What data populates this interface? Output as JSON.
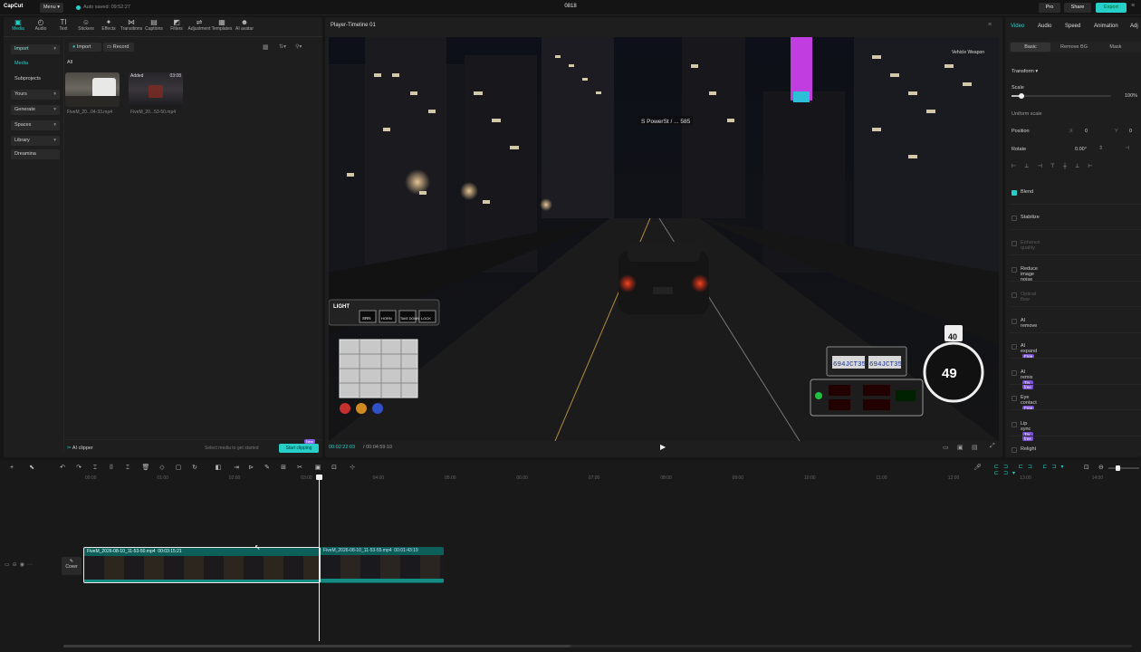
{
  "app": {
    "logo": "CapCut",
    "menu": "Menu",
    "autosave": "Auto saved: 09:52:27",
    "project_title": "0818",
    "pro": "Pro",
    "share": "Share",
    "export": "Export"
  },
  "toolbar": [
    {
      "label": "Media",
      "icon": "▣"
    },
    {
      "label": "Audio",
      "icon": "◴"
    },
    {
      "label": "Text",
      "icon": "TI"
    },
    {
      "label": "Stickers",
      "icon": "☺"
    },
    {
      "label": "Effects",
      "icon": "✦"
    },
    {
      "label": "Transitions",
      "icon": "⋈"
    },
    {
      "label": "Captions",
      "icon": "▤"
    },
    {
      "label": "Filters",
      "icon": "◩"
    },
    {
      "label": "Adjustment",
      "icon": "⇌"
    },
    {
      "label": "Templates",
      "icon": "▦"
    },
    {
      "label": "AI avatar",
      "icon": "☻"
    }
  ],
  "sidebar": [
    {
      "label": "Import",
      "chev": "▾",
      "pill": true
    },
    {
      "label": "Media",
      "pill": false,
      "active": true
    },
    {
      "label": "Subprojects",
      "pill": false
    },
    {
      "label": "Yours",
      "chev": "▾",
      "pill": true
    },
    {
      "label": "Generate",
      "chev": "▾",
      "pill": true
    },
    {
      "label": "Spaces",
      "chev": "▾",
      "pill": true
    },
    {
      "label": "Library",
      "chev": "▾",
      "pill": true
    },
    {
      "label": "Dreamina",
      "pill": true
    }
  ],
  "media": {
    "import_btn": "Import",
    "record_btn": "Record",
    "filter_all": "All",
    "items": [
      {
        "name": "FiveM_20...04-33.mp4",
        "duration": "",
        "badge": ""
      },
      {
        "name": "FiveM_20...53-50.mp4",
        "duration": "03:08",
        "badge": "Added"
      }
    ],
    "ai_clipper": "AI clipper",
    "hint": "Select media to get started",
    "start_clipping": "Start clipping",
    "new_badge": "New"
  },
  "player": {
    "title": "Player-Timeline 01",
    "current_time": "00:02:22:03",
    "total_time": "00:04:59:10",
    "hud": {
      "street": "S PowerSt / ... 585",
      "speed": "49",
      "speed_limit": "40",
      "radar_plate1": "694JCT35",
      "radar_plate2": "694JCT35",
      "panel_btns": [
        "SRN",
        "HORN",
        "TAKE DOWN",
        "LOCK"
      ],
      "panel_brand": "LIGHT",
      "vehicle_weapon": "Vehicle Weapon"
    }
  },
  "inspector": {
    "tabs": [
      "Video",
      "Audio",
      "Speed",
      "Animation",
      "Adj"
    ],
    "subtabs": [
      "Basic",
      "Remove BG",
      "Mask"
    ],
    "transform": "Transform",
    "scale": "Scale",
    "scale_value": "100%",
    "scale_level": 0.1,
    "uniform_scale": "Uniform scale",
    "position": "Position",
    "pos_x_label": "X",
    "pos_x": "0",
    "pos_y_label": "Y",
    "pos_y": "0",
    "rotate": "Rotate",
    "rotate_value": "0.00°",
    "features": [
      {
        "label": "Blend",
        "on": true,
        "dim": false,
        "tag": ""
      },
      {
        "label": "Stabilize",
        "on": false,
        "dim": false,
        "tag": ""
      },
      {
        "label": "Enhance quality",
        "on": false,
        "dim": true,
        "tag": ""
      },
      {
        "label": "Reduce image noise",
        "on": false,
        "dim": false,
        "tag": ""
      },
      {
        "label": "Optical flow",
        "on": false,
        "dim": true,
        "tag": ""
      },
      {
        "label": "AI remove",
        "on": false,
        "dim": false,
        "tag": ""
      },
      {
        "label": "AI expand",
        "on": false,
        "dim": false,
        "tag": "Free"
      },
      {
        "label": "AI remix",
        "on": false,
        "dim": false,
        "tag": "Try free"
      },
      {
        "label": "Eye contact",
        "on": false,
        "dim": false,
        "tag": "Free"
      },
      {
        "label": "Lip sync",
        "on": false,
        "dim": false,
        "tag": "Try free"
      },
      {
        "label": "Relight",
        "on": false,
        "dim": false,
        "tag": ""
      }
    ]
  },
  "timeline": {
    "ruler": [
      "00:00",
      "01:00",
      "02:00",
      "03:00",
      "04:00",
      "05:00",
      "06:00",
      "07:00",
      "08:00",
      "09:00",
      "10:00",
      "11:00",
      "12:00",
      "13:00",
      "14:00"
    ],
    "clip1": {
      "name": "FiveM_2026-08-10_11-53-50.mp4",
      "duration": "00:03:15:21"
    },
    "clip2": {
      "name": "FiveM_2026-08-10_11-53-55.mp4",
      "duration": "00:01:43:19"
    },
    "cover": "Cover"
  },
  "colors": {
    "accent": "#26d0c8",
    "panel": "#1e1e1e",
    "bg": "#161616"
  }
}
